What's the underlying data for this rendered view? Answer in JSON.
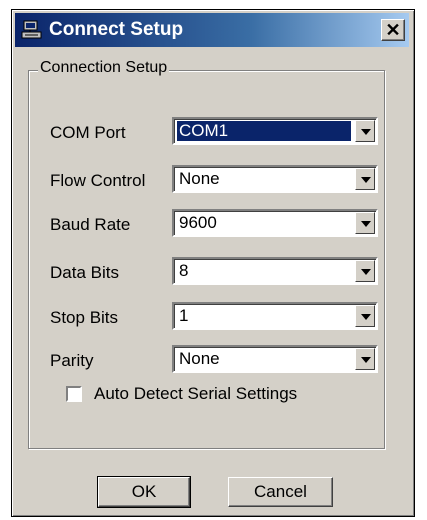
{
  "window": {
    "title": "Connect Setup",
    "close_glyph": "✕"
  },
  "group": {
    "label": "Connection Setup"
  },
  "fields": [
    {
      "label": "COM Port",
      "value": "COM1",
      "focused": true
    },
    {
      "label": "Flow Control",
      "value": "None"
    },
    {
      "label": "Baud Rate",
      "value": "9600"
    },
    {
      "label": "Data Bits",
      "value": "8"
    },
    {
      "label": "Stop Bits",
      "value": "1"
    },
    {
      "label": "Parity",
      "value": "None"
    }
  ],
  "auto_detect": {
    "label": "Auto Detect Serial Settings",
    "checked": false
  },
  "buttons": {
    "ok": "OK",
    "cancel": "Cancel"
  },
  "colors": {
    "titlebar_start": "#0a246a",
    "face": "#d4d0c8",
    "selection": "#0a246a"
  }
}
